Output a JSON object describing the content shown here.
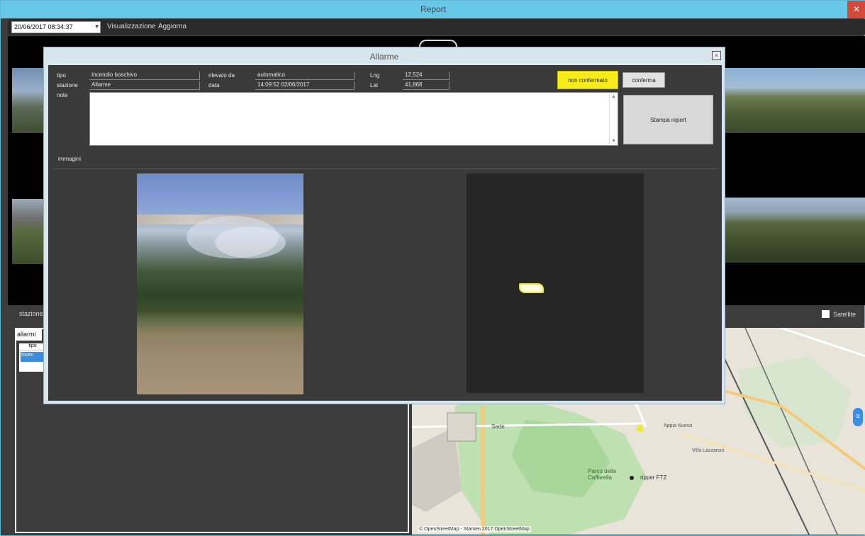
{
  "window": {
    "title": "Report",
    "close_glyph": "✕"
  },
  "toolbar": {
    "date_value": "20/06/2017 08:34:37",
    "menu_view": "Visualizzazione",
    "menu_refresh": "Aggiorna"
  },
  "side": {
    "station_label": "stazione",
    "layers_label": "Satellite"
  },
  "alarm_list": {
    "tab_label": "allarmi",
    "column_header": "tipo",
    "selected_item": "Incen"
  },
  "map": {
    "attribution": "© OpenStreetMap - Stamen 2017 OpenStreetMap",
    "zoom_glyph": "≡",
    "labels": {
      "place_1": "Sede",
      "place_2": "Parco della Caffarella",
      "poi": "ripper FTZ",
      "place_3": "Villa Lazzaroni",
      "place_4": "Appia Nuova"
    }
  },
  "dialog": {
    "title": "Allarme",
    "close_glyph": "×",
    "fields": {
      "tipo_label": "tipo",
      "tipo_value": "Incendio boschivo",
      "stazione_label": "stazione",
      "stazione_value": "Allarme",
      "note_label": "note",
      "rilevato_label": "rilevato da",
      "rilevato_value": "automatico",
      "data_label": "data",
      "data_value": "14:09:52 02/06/2017",
      "lng_label": "Lng",
      "lng_value": "12,524",
      "lat_label": "Lat",
      "lat_value": "41,868"
    },
    "btn_not_confirmed": "non confermato",
    "btn_confirm": "conferma",
    "btn_print": "Stampa report",
    "images_label": "immagini"
  }
}
